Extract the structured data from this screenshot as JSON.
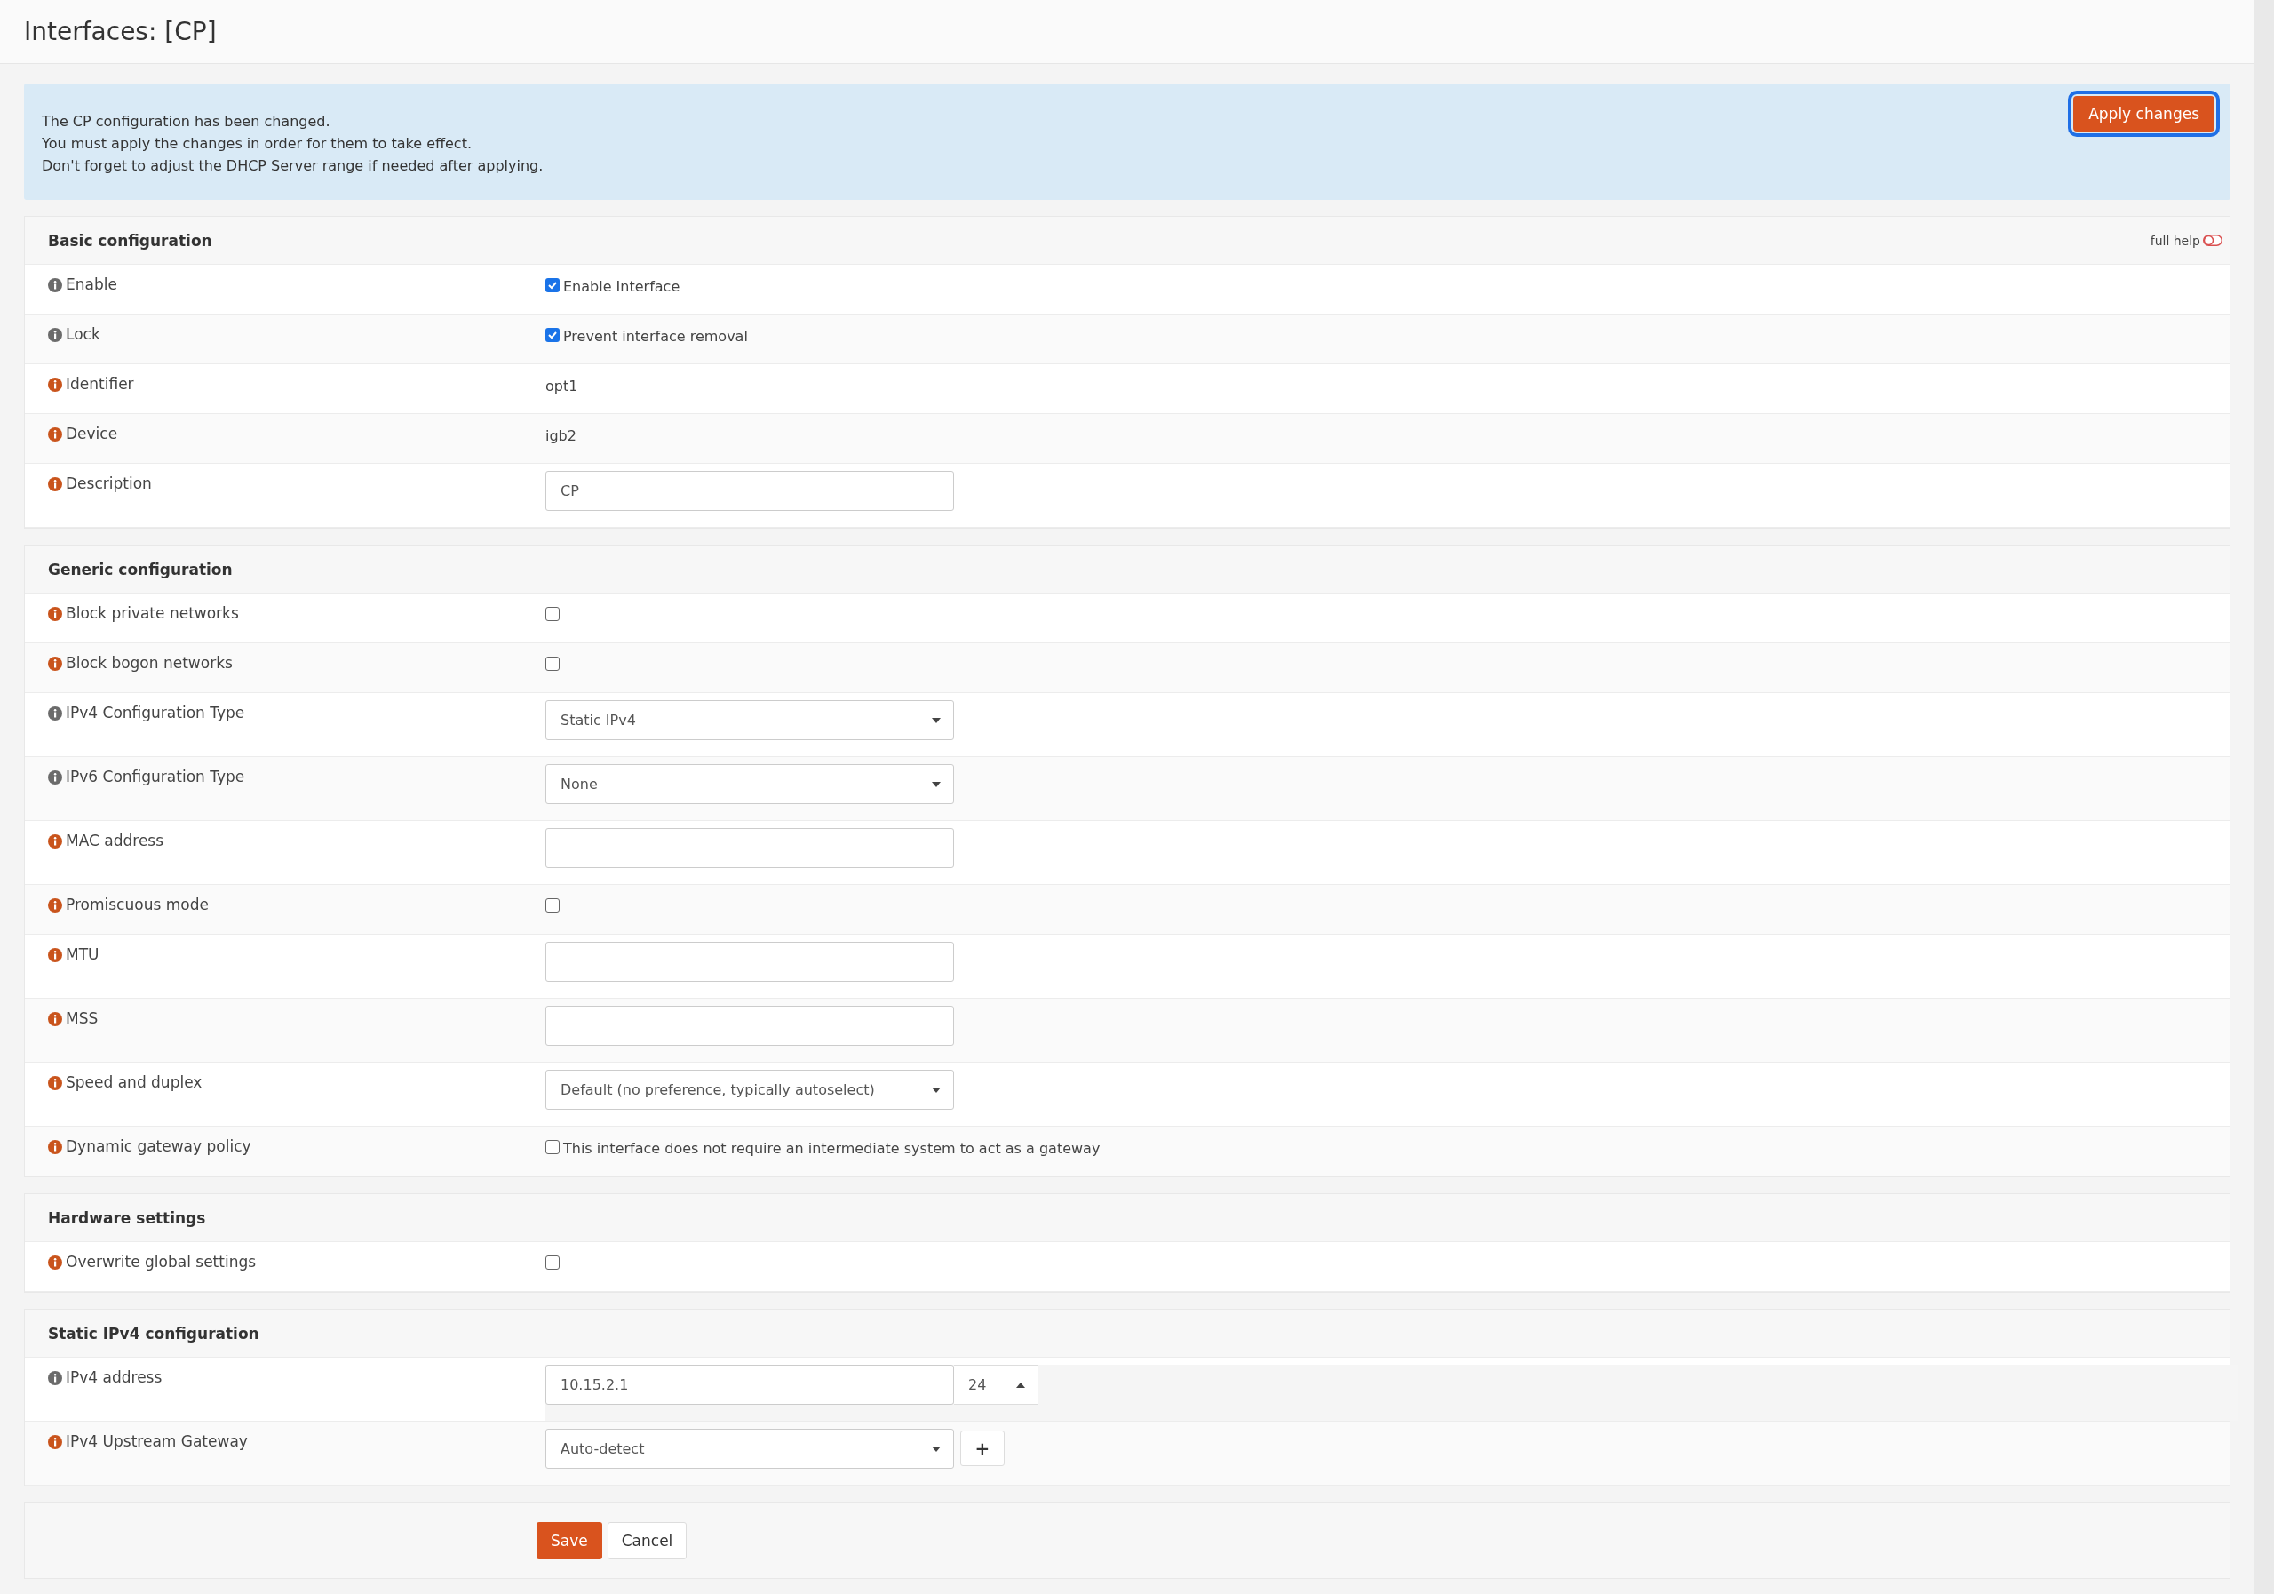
{
  "page_title": "Interfaces: [CP]",
  "alert": {
    "lines": [
      "The CP configuration has been changed.",
      "You must apply the changes in order for them to take effect.",
      "Don't forget to adjust the DHCP Server range if needed after applying."
    ],
    "button": "Apply changes"
  },
  "sections": [
    {
      "title": "Basic configuration",
      "full_help": {
        "label": "full help",
        "on": false
      },
      "rows": [
        {
          "kind": "checkbox",
          "label": "Enable",
          "color": "#6b6b6b",
          "checked": true,
          "text": "Enable Interface"
        },
        {
          "kind": "checkbox",
          "label": "Lock",
          "color": "#6b6b6b",
          "checked": true,
          "text": "Prevent interface removal"
        },
        {
          "kind": "text",
          "label": "Identifier",
          "color": "#c9541c",
          "value": "opt1"
        },
        {
          "kind": "text",
          "label": "Device",
          "color": "#c9541c",
          "value": "igb2"
        },
        {
          "kind": "input",
          "label": "Description",
          "color": "#c9541c",
          "value": "CP"
        }
      ]
    },
    {
      "title": "Generic configuration",
      "rows": [
        {
          "kind": "checkbox",
          "label": "Block private networks",
          "color": "#c9541c",
          "checked": false
        },
        {
          "kind": "checkbox",
          "label": "Block bogon networks",
          "color": "#c9541c",
          "checked": false
        },
        {
          "kind": "select",
          "label": "IPv4 Configuration Type",
          "color": "#6b6b6b",
          "value": "Static IPv4"
        },
        {
          "kind": "select",
          "label": "IPv6 Configuration Type",
          "color": "#6b6b6b",
          "value": "None"
        },
        {
          "kind": "input",
          "label": "MAC address",
          "color": "#c9541c"
        },
        {
          "kind": "checkbox",
          "label": "Promiscuous mode",
          "color": "#c9541c",
          "checked": false
        },
        {
          "kind": "input",
          "label": "MTU",
          "color": "#c9541c"
        },
        {
          "kind": "input",
          "label": "MSS",
          "color": "#c9541c"
        },
        {
          "kind": "select",
          "label": "Speed and duplex",
          "color": "#c9541c",
          "value": "Default (no preference, typically autoselect)"
        },
        {
          "kind": "checkbox",
          "label": "Dynamic gateway policy",
          "color": "#c9541c",
          "checked": false,
          "text": "This interface does not require an intermediate system to act as a gateway"
        }
      ]
    },
    {
      "title": "Hardware settings",
      "rows": [
        {
          "kind": "checkbox",
          "label": "Overwrite global settings",
          "color": "#c9541c",
          "checked": false
        }
      ]
    },
    {
      "title": "Static IPv4 configuration",
      "rows": [
        {
          "kind": "address",
          "label": "IPv4 address",
          "color": "#6b6b6b",
          "value": "10.15.2.1",
          "mask": "24"
        },
        {
          "kind": "select_add",
          "label": "IPv4 Upstream Gateway",
          "color": "#c9541c",
          "value": "Auto-detect",
          "add": "+"
        }
      ]
    }
  ],
  "actions": {
    "save": "Save",
    "cancel": "Cancel"
  }
}
